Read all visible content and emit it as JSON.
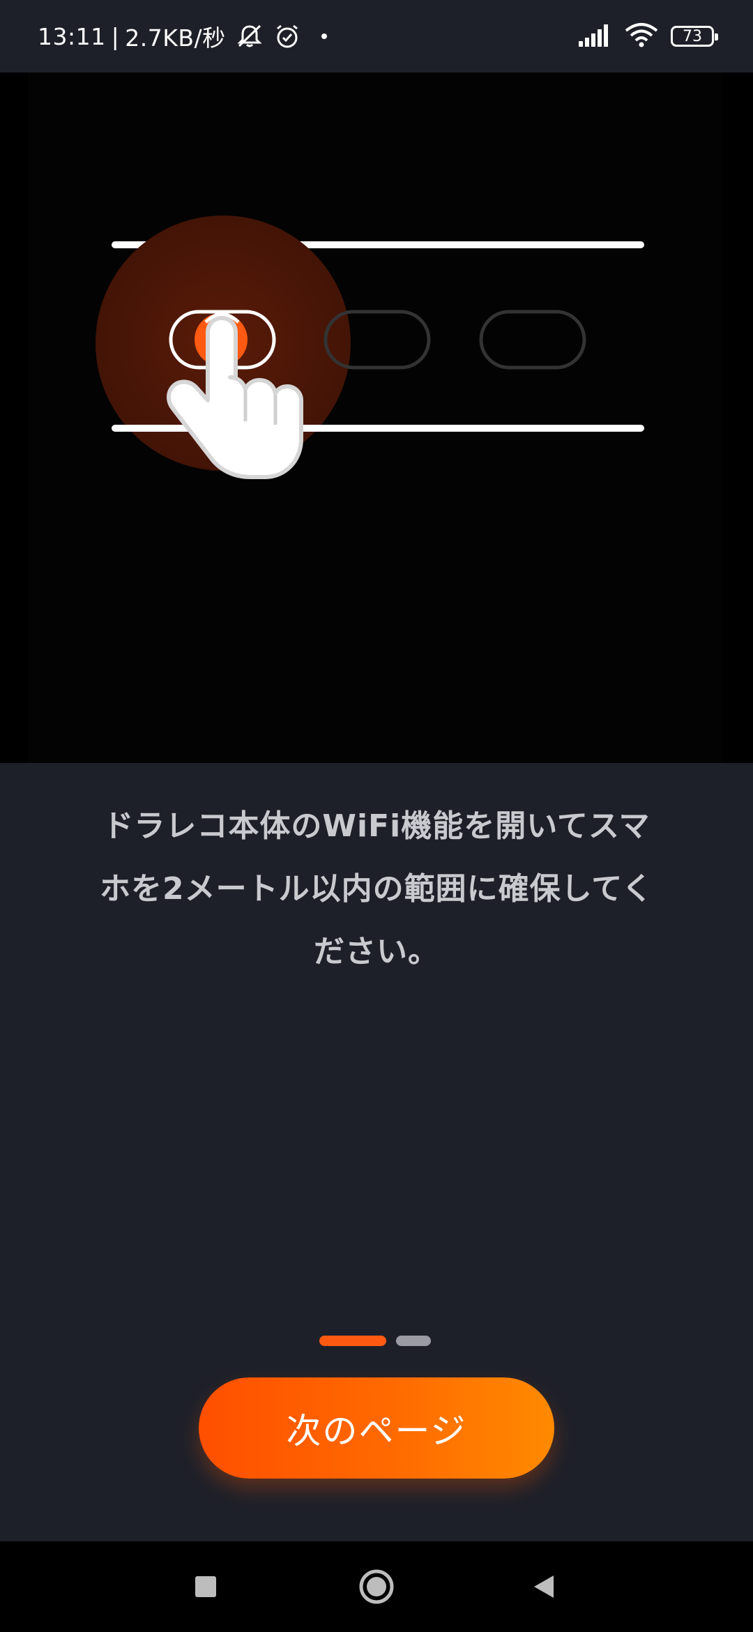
{
  "status_bar": {
    "time": "13:11",
    "separator": "|",
    "network_speed": "2.7KB/秒",
    "battery_level": "73",
    "icons": [
      "mute-bell-icon",
      "alarm-icon",
      "dot-icon",
      "signal-icon",
      "wifi-icon",
      "battery-icon"
    ]
  },
  "illustration": {
    "icons": [
      "hand-pointer-icon",
      "button-outline-icon"
    ],
    "colors": {
      "accent": "#ff5a12",
      "glow": "#4a1608",
      "line": "#ffffff",
      "outline": "#333333"
    }
  },
  "instruction": {
    "line1": "ドラレコ本体のWiFi機能を開いてスマ",
    "line2": "ホを2メートル以内の範囲に確保してく",
    "line3": "ださい。"
  },
  "pager": {
    "total": 2,
    "current": 1
  },
  "next_button": {
    "label": "次のページ"
  },
  "nav_bar": {
    "icons": [
      "recent-apps-icon",
      "home-icon",
      "back-icon"
    ]
  },
  "colors": {
    "background": "#1e2029",
    "primary": "#ff5a12",
    "text": "#c9cacf"
  }
}
